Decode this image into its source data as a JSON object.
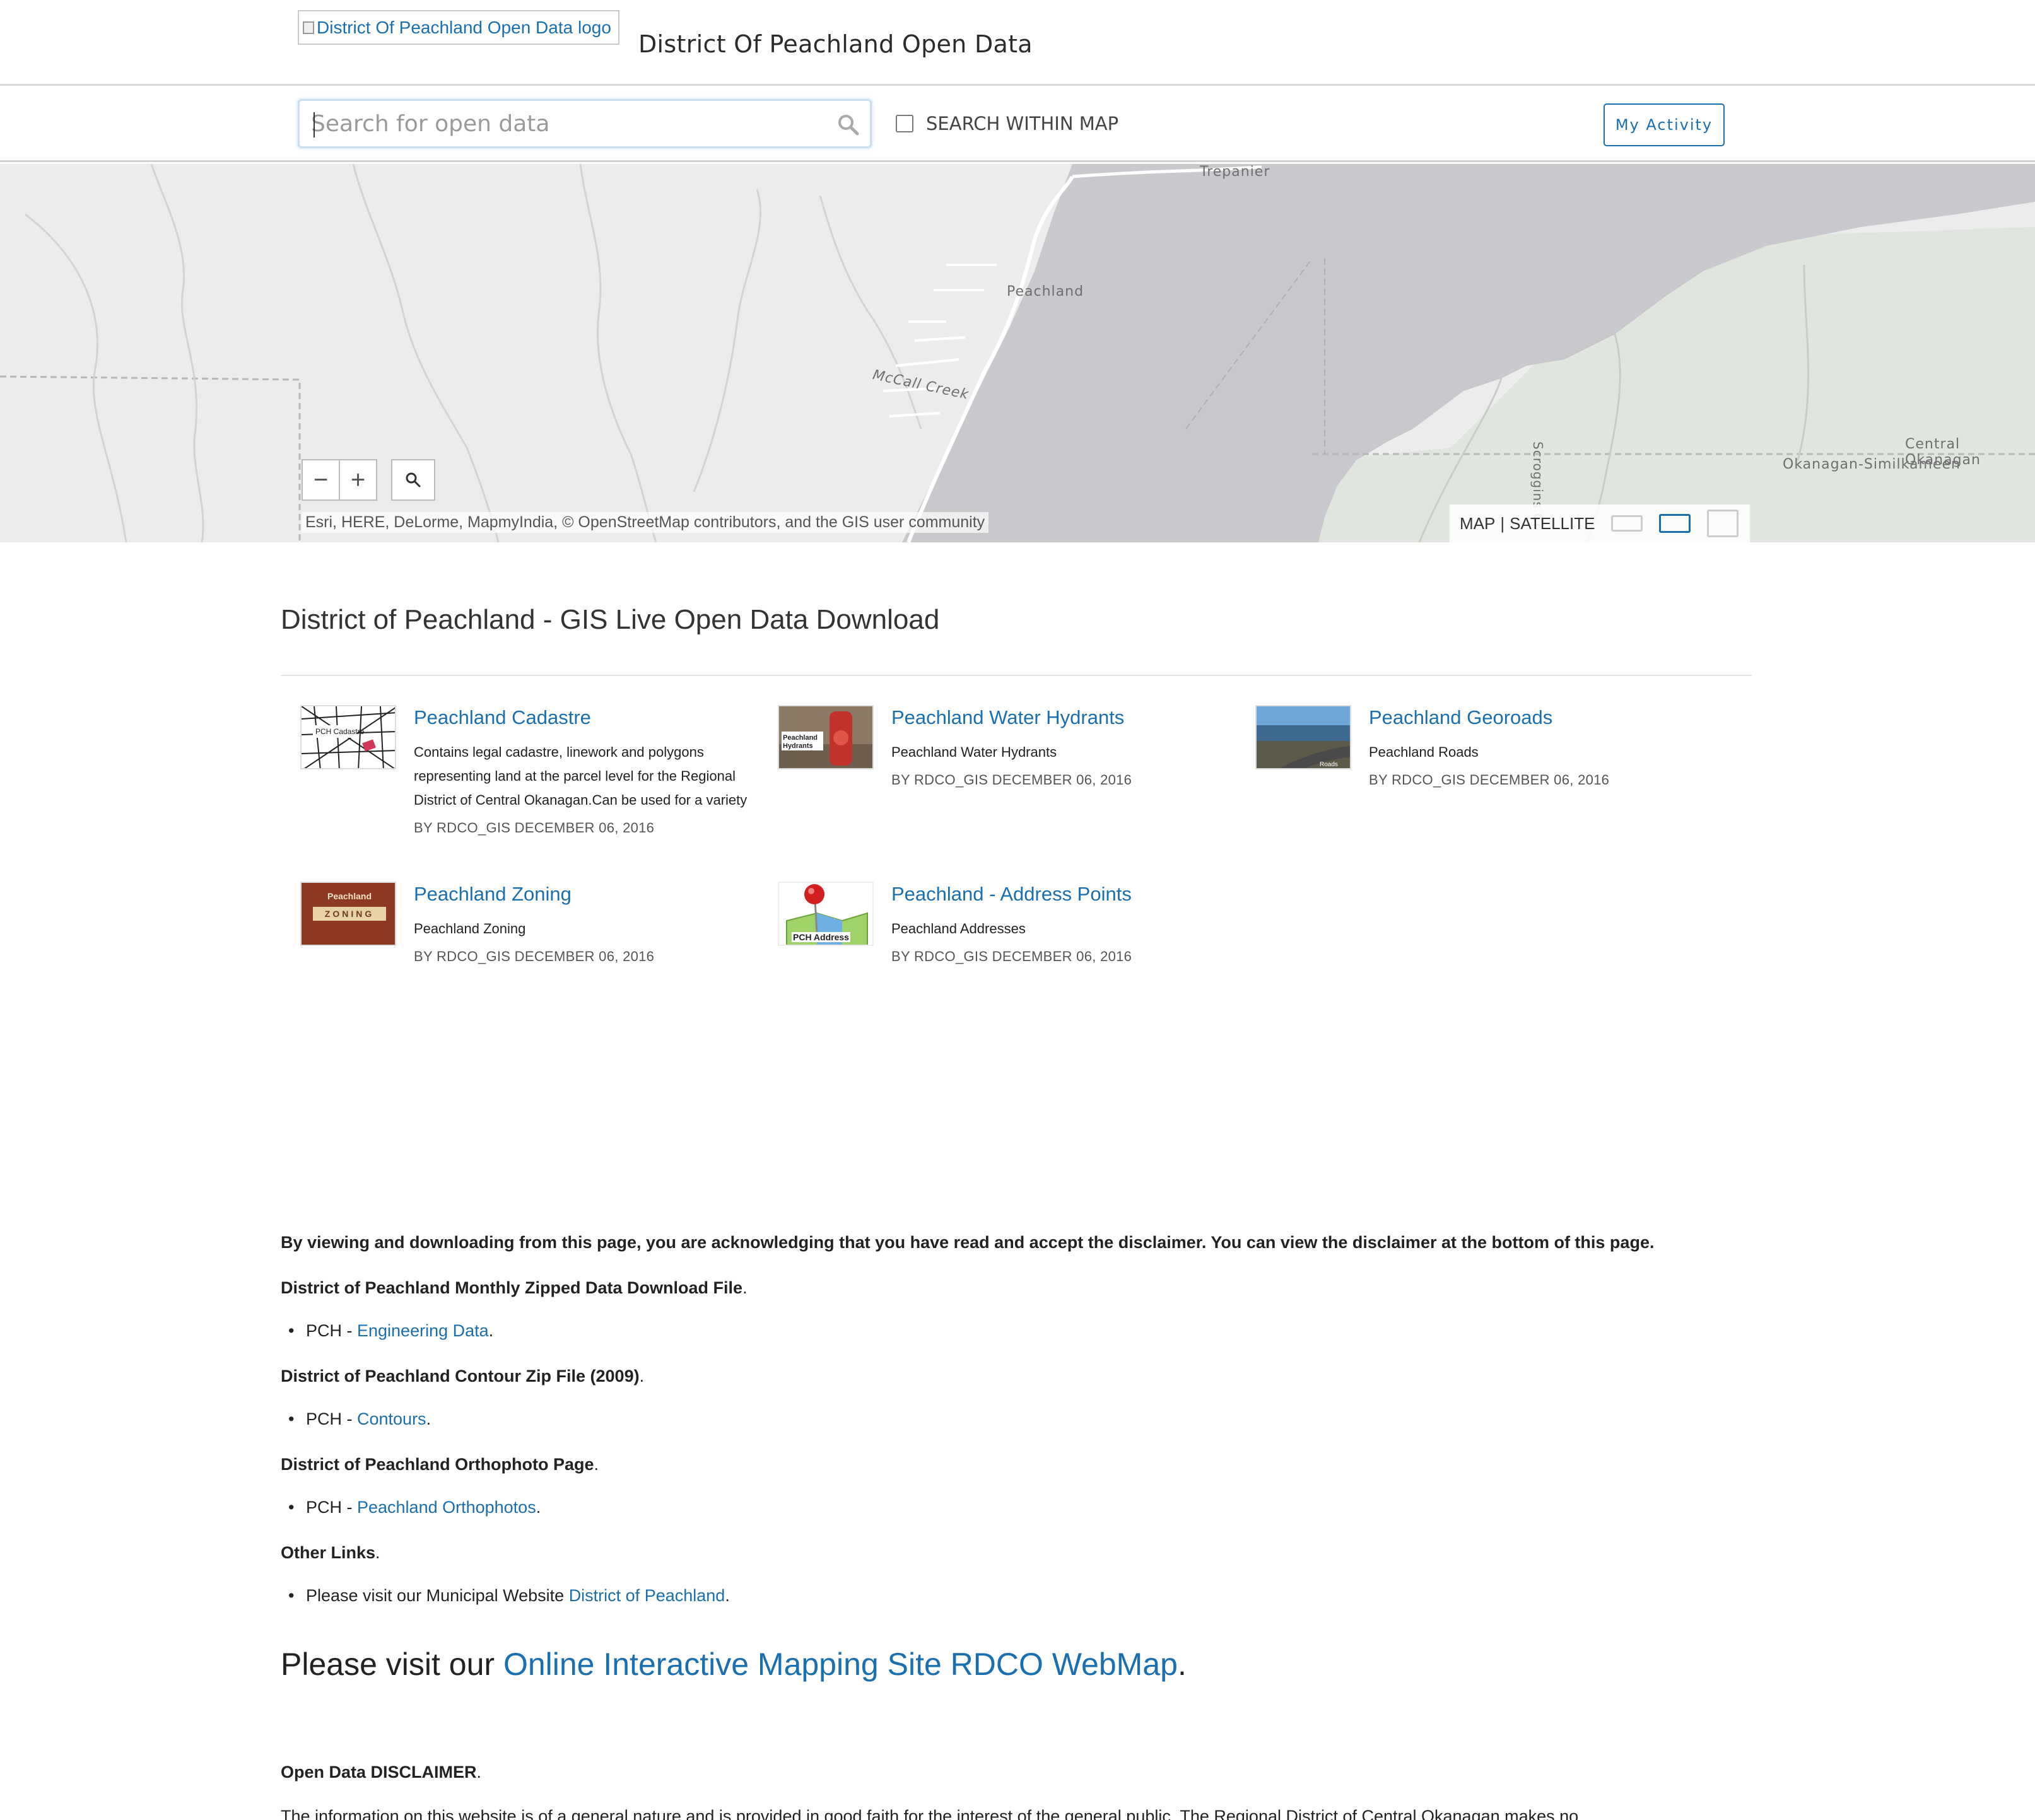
{
  "header": {
    "logo_alt": "District Of Peachland Open Data logo",
    "site_title": "District Of Peachland Open Data"
  },
  "search": {
    "placeholder": "Search for open data",
    "within_map_label": "SEARCH WITHIN MAP",
    "activity_button": "My Activity"
  },
  "map": {
    "labels": [
      "Trepanier",
      "Peachland",
      "McCall Creek",
      "Scroggins Cr",
      "Central Okanagan",
      "Okanagan-Similkameen"
    ],
    "zoom_out": "−",
    "zoom_in": "+",
    "attribution": "Esri, HERE, DeLorme, MapmyIndia, © OpenStreetMap contributors, and the GIS user community",
    "basemap": {
      "map_label": "MAP",
      "separator": "|",
      "satellite_label": "SATELLITE"
    }
  },
  "section_title": "District of Peachland - GIS Live Open Data Download",
  "datasets": [
    {
      "title": "Peachland Cadastre",
      "description": "Contains legal cadastre, linework and polygons representing land at the parcel level for the Regional District of Central Okanagan.Can be used for a variety",
      "meta": "BY RDCO_GIS DECEMBER 06, 2016",
      "thumb_text": "PCH Cadastre"
    },
    {
      "title": "Peachland Water Hydrants",
      "description": "Peachland Water Hydrants",
      "meta": "BY RDCO_GIS DECEMBER 06, 2016",
      "thumb_text": "Peachland Hydrants"
    },
    {
      "title": "Peachland Georoads",
      "description": "Peachland Roads",
      "meta": "BY RDCO_GIS DECEMBER 06, 2016",
      "thumb_text": "Roads"
    },
    {
      "title": "Peachland Zoning",
      "description": "Peachland Zoning",
      "meta": "BY RDCO_GIS DECEMBER 06, 2016",
      "thumb_text_top": "Peachland",
      "thumb_text_bottom": "ZONING"
    },
    {
      "title": "Peachland - Address Points",
      "description": "Peachland Addresses",
      "meta": "BY RDCO_GIS DECEMBER 06, 2016",
      "thumb_text": "PCH Address"
    }
  ],
  "content": {
    "notice": "By viewing and downloading from this page, you are acknowledging that you have read and accept the disclaimer. You can view the disclaimer at the bottom of this page.",
    "monthly_heading": "District of Peachland Monthly Zipped Data Download File",
    "monthly_prefix": "PCH - ",
    "monthly_link": "Engineering Data",
    "contour_heading": "District of Peachland Contour Zip File (2009)",
    "contour_prefix": "PCH - ",
    "contour_link": "Contours",
    "ortho_heading": "District of Peachland Orthophoto Page",
    "ortho_prefix": "PCH - ",
    "ortho_link": "Peachland Orthophotos",
    "other_heading": "Other Links",
    "other_prefix": "Please visit our Municipal Website ",
    "other_link": "District of Peachland",
    "big_prefix": "Please visit our ",
    "big_link": "Online Interactive Mapping Site RDCO WebMap",
    "disclaimer_heading": "Open Data DISCLAIMER",
    "disclaimer_text": "The information on this website is of a general nature and is provided in good faith for the interest of the general public. The Regional District of Central Okanagan makes no"
  },
  "colors": {
    "link": "#1a6fb0",
    "lake": "#c9c9cd",
    "land": "#ececec",
    "park": "#e0e6df"
  }
}
